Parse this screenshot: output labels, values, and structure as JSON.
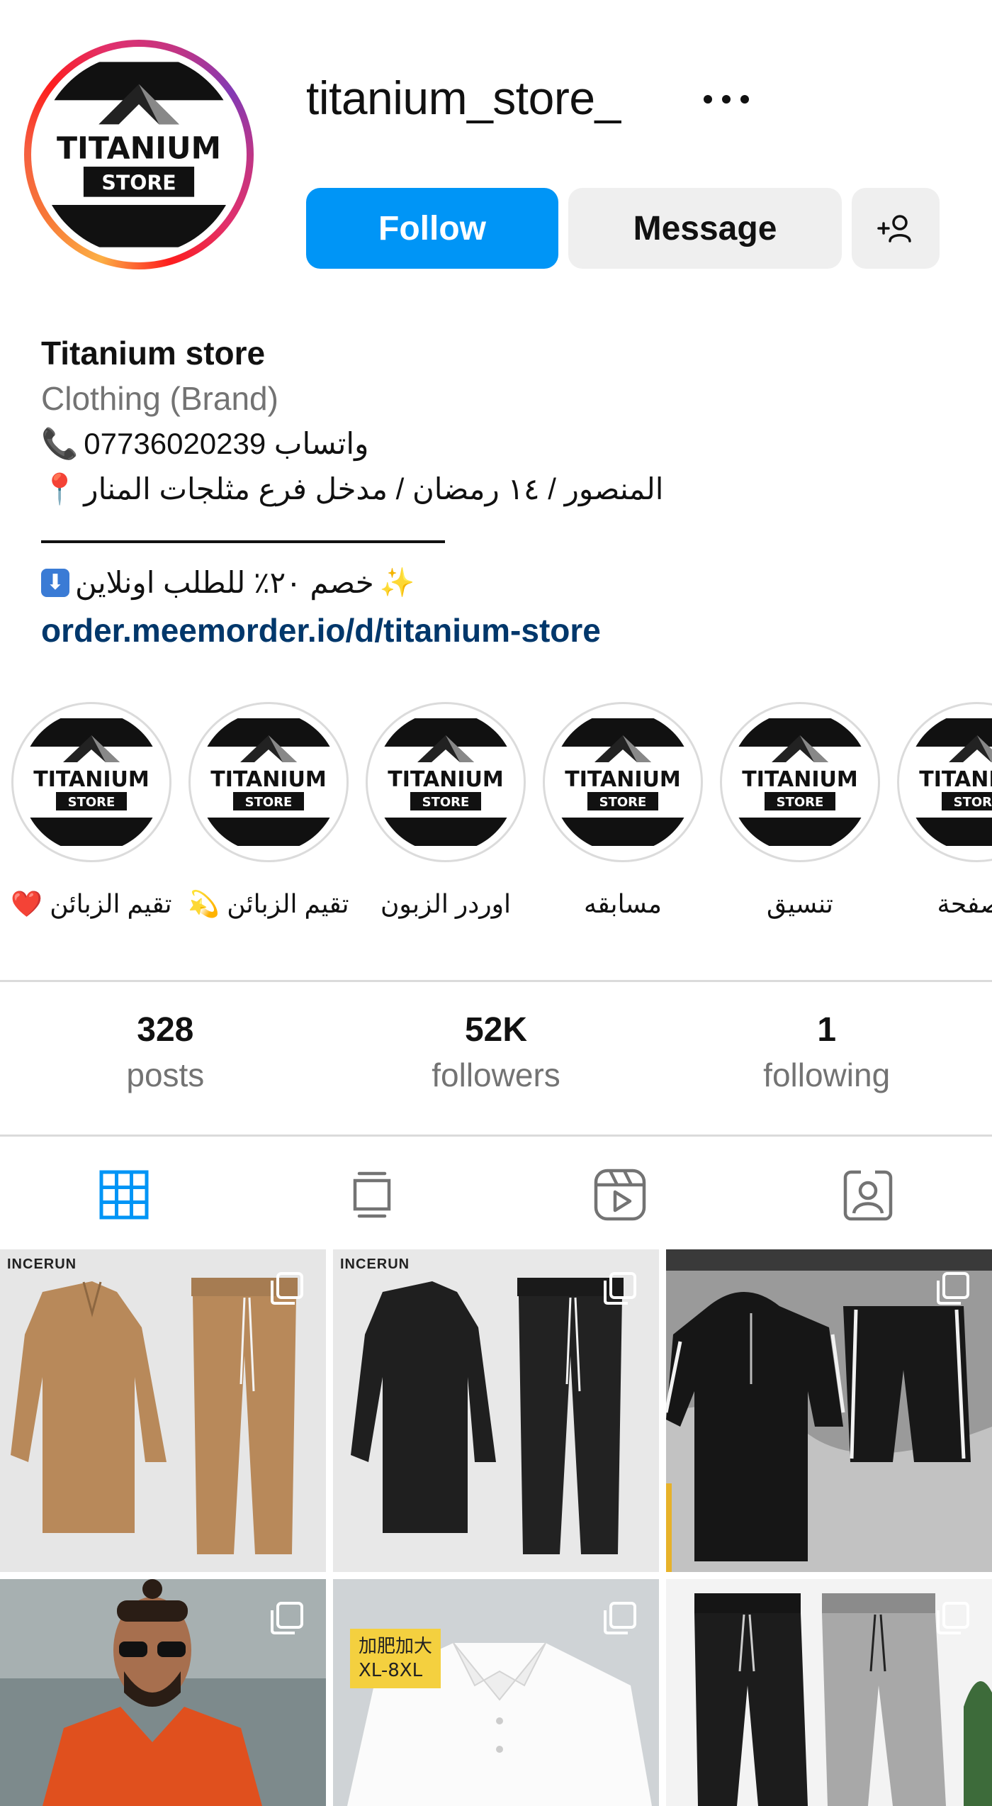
{
  "profile": {
    "username": "titanium_store_",
    "follow_label": "Follow",
    "message_label": "Message",
    "add_person_icon": "person-plus-icon"
  },
  "logo": {
    "line1": "TITANIUM",
    "line2": "STORE"
  },
  "bio": {
    "name": "Titanium store",
    "category": "Clothing (Brand)",
    "phone_line": "واتساب 07736020239",
    "address_line": "المنصور / ١٤ رمضان / مدخل فرع مثلجات المنار",
    "promo_line": "خصم ٢٠٪ للطلب اونلاين",
    "link": "order.meemorder.io/d/titanium-store"
  },
  "highlights": [
    {
      "label": "تقيم الزبائن ❤️"
    },
    {
      "label": "تقيم الزبائن 💫"
    },
    {
      "label": "اوردر الزبون"
    },
    {
      "label": "مسابقه"
    },
    {
      "label": "تنسيق"
    },
    {
      "label": "الصفحة"
    }
  ],
  "stats": {
    "posts_count": "328",
    "posts_label": "posts",
    "followers_count": "52K",
    "followers_label": "followers",
    "following_count": "1",
    "following_label": "following"
  },
  "tabs": [
    {
      "icon": "grid-icon",
      "active": true
    },
    {
      "icon": "feed-icon",
      "active": false
    },
    {
      "icon": "reels-icon",
      "active": false
    },
    {
      "icon": "tagged-icon",
      "active": false
    }
  ],
  "posts": {
    "brand_1": "INCERUN",
    "brand_2": "INCERUN",
    "size_tag_line1": "加肥加大",
    "size_tag_line2": "XL-8XL"
  },
  "colors": {
    "follow_blue": "#0095f6",
    "link_blue": "#00376b",
    "secondary_gray": "#737373",
    "button_gray": "#efefef"
  }
}
